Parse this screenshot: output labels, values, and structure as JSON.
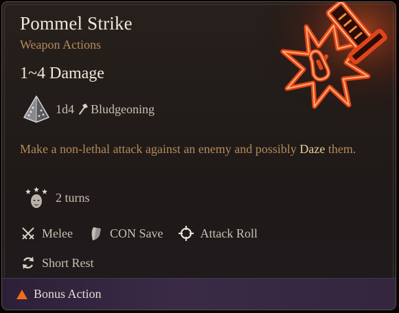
{
  "tooltip": {
    "title": "Pommel Strike",
    "subtitle": "Weapon Actions",
    "damage": "1~4 Damage",
    "dice": "1d4",
    "damage_type": "Bludgeoning",
    "description_before": "Make a non-lethal attack against an enemy and possibly ",
    "description_keyword": "Daze",
    "description_after": " them.",
    "condition_duration": "2 turns",
    "tags": {
      "melee": "Melee",
      "save": "CON Save",
      "attack": "Attack Roll"
    },
    "rest": "Short Rest",
    "action_type": "Bonus Action",
    "icons": [
      "sword-fist-art",
      "d4-dice-icon",
      "hammer-icon",
      "dazed-head-icon",
      "crossed-swords-icon",
      "shield-icon",
      "crosshair-icon",
      "refresh-icon",
      "triangle-icon"
    ],
    "colors": {
      "title": "#f1e7da",
      "subtitle": "#b48a5a",
      "keyword": "#e8d29a",
      "art_glow": "#e2441a",
      "action_triangle": "#f06b1c",
      "footer": "#3a2a47"
    }
  }
}
